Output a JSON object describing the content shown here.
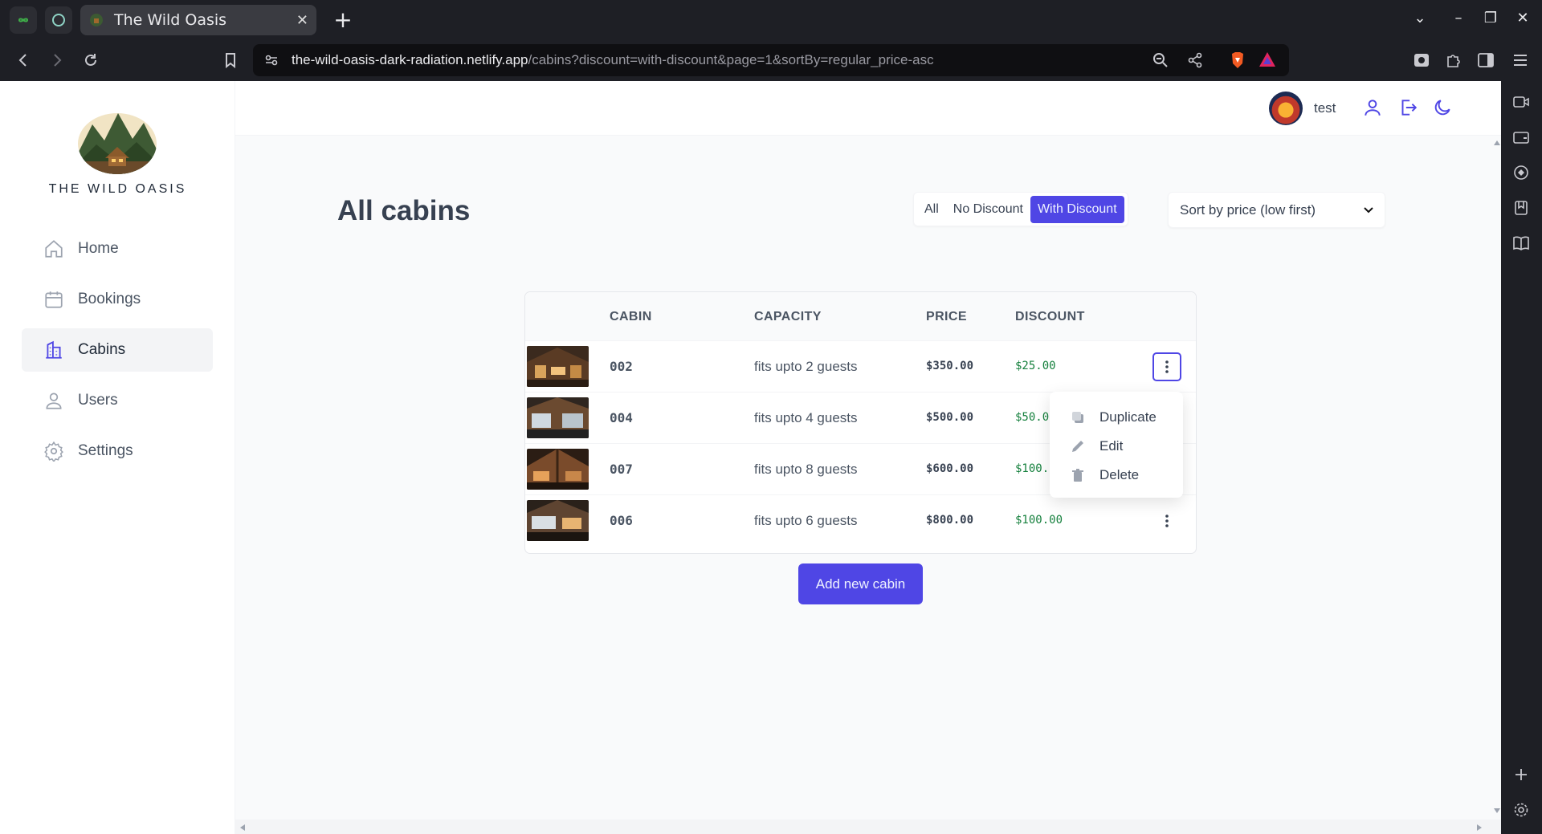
{
  "browser": {
    "tab_title": "The Wild Oasis",
    "url_host": "the-wild-oasis-dark-radiation.netlify.app",
    "url_path": "/cabins?discount=with-discount&page=1&sortBy=regular_price-asc"
  },
  "brand": {
    "name": "THE WILD OASIS"
  },
  "sidebar": {
    "items": [
      {
        "label": "Home",
        "icon": "home-icon"
      },
      {
        "label": "Bookings",
        "icon": "calendar-icon"
      },
      {
        "label": "Cabins",
        "icon": "building-icon",
        "active": true
      },
      {
        "label": "Users",
        "icon": "user-icon"
      },
      {
        "label": "Settings",
        "icon": "gear-icon"
      }
    ]
  },
  "header": {
    "username": "test"
  },
  "page": {
    "title": "All cabins",
    "filters": [
      "All",
      "No Discount",
      "With Discount"
    ],
    "active_filter": "With Discount",
    "sort_label": "Sort by price (low first)",
    "add_button": "Add new cabin"
  },
  "table": {
    "headers": [
      "CABIN",
      "CAPACITY",
      "PRICE",
      "DISCOUNT"
    ],
    "rows": [
      {
        "cabin": "002",
        "capacity": "fits upto 2 guests",
        "price": "$350.00",
        "discount": "$25.00"
      },
      {
        "cabin": "004",
        "capacity": "fits upto 4 guests",
        "price": "$500.00",
        "discount": "$50.00"
      },
      {
        "cabin": "007",
        "capacity": "fits upto 8 guests",
        "price": "$600.00",
        "discount": "$100.00"
      },
      {
        "cabin": "006",
        "capacity": "fits upto 6 guests",
        "price": "$800.00",
        "discount": "$100.00"
      }
    ]
  },
  "menu": {
    "items": [
      "Duplicate",
      "Edit",
      "Delete"
    ]
  },
  "colors": {
    "accent": "#4f46e5",
    "discount": "#15803d"
  }
}
